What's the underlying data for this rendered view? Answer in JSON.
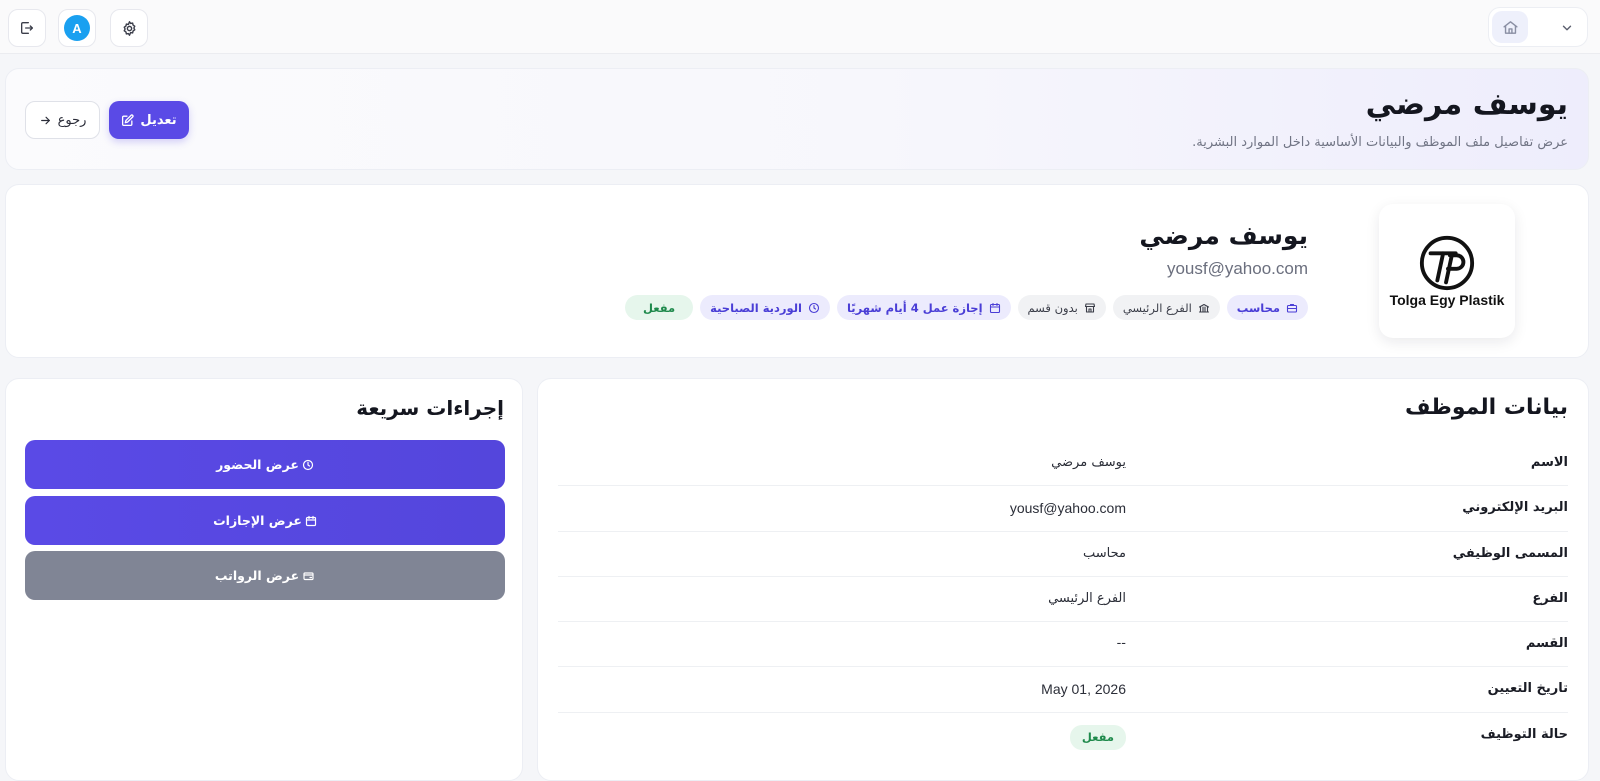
{
  "topbar": {
    "avatar_letter": "A",
    "icons": [
      "logout-icon",
      "settings-icon",
      "home-icon",
      "chevron-down-icon"
    ]
  },
  "header": {
    "title": "يوسف مرضي",
    "subtitle": "عرض تفاصيل ملف الموظف والبيانات الأساسية داخل الموارد البشرية.",
    "edit_label": "تعديل",
    "back_label": "رجوع"
  },
  "profile": {
    "logo_text": "Tolga Egy Plastik",
    "name": "يوسف مرضي",
    "email": "yousf@yahoo.com",
    "chips": {
      "job": "محاسب",
      "branch": "الفرع الرئيسي",
      "department": "بدون قسم",
      "leave": "إجازة عمل 4 أيام شهريًا",
      "shift": "الوردية الصباحية",
      "status": "مفعل"
    }
  },
  "details": {
    "title": "بيانات الموظف",
    "rows": [
      {
        "label": "الاسم",
        "value": "يوسف مرضي"
      },
      {
        "label": "البريد الإلكتروني",
        "value": "yousf@yahoo.com"
      },
      {
        "label": "المسمى الوظيفي",
        "value": "محاسب"
      },
      {
        "label": "الفرع",
        "value": "الفرع الرئيسي"
      },
      {
        "label": "القسم",
        "value": "--"
      },
      {
        "label": "تاريخ التعيين",
        "value": "May 01, 2026"
      },
      {
        "label": "حالة التوظيف",
        "value": "مفعل"
      }
    ]
  },
  "quick_actions": {
    "title": "إجراءات سريعة",
    "attendance": "عرض الحضور",
    "leaves": "عرض الإجازات",
    "salaries": "عرض الرواتب"
  },
  "colors": {
    "primary": "#5a4ae6",
    "secondary_button": "#808595",
    "success": "#1f8a4c",
    "avatar": "#1aa0f0"
  }
}
